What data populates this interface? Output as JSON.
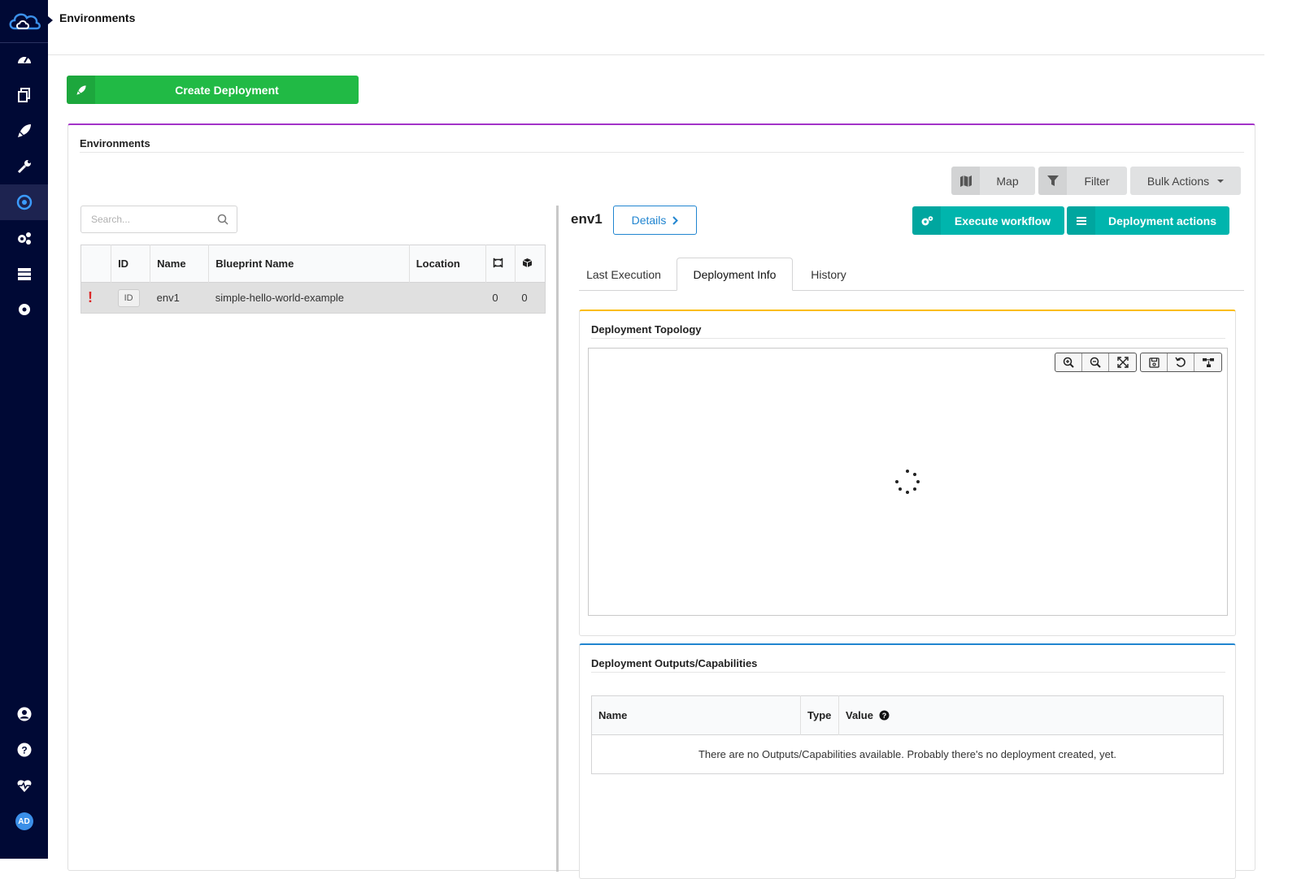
{
  "breadcrumb": "Environments",
  "create_button": "Create Deployment",
  "widget": {
    "title": "Environments",
    "toolbar": {
      "map": "Map",
      "filter": "Filter",
      "bulk_actions": "Bulk Actions"
    },
    "search_placeholder": "Search...",
    "table": {
      "headers": [
        "ID",
        "Name",
        "Blueprint Name",
        "Location"
      ],
      "rows": [
        {
          "id": "ID",
          "name": "env1",
          "blueprint": "simple-hello-world-example",
          "location": "",
          "count1": "0",
          "count2": "0"
        }
      ]
    }
  },
  "detail": {
    "env_name": "env1",
    "details_button": "Details",
    "execute_workflow": "Execute workflow",
    "deployment_actions": "Deployment actions",
    "tabs": [
      "Last Execution",
      "Deployment Info",
      "History"
    ],
    "topology_title": "Deployment Topology",
    "outputs_title": "Deployment Outputs/Capabilities",
    "outputs_headers": {
      "name": "Name",
      "type": "Type",
      "value": "Value"
    },
    "outputs_empty": "There are no Outputs/Capabilities available. Probably there's no deployment created, yet."
  },
  "sidebar": {
    "avatar_initials": "AD",
    "icons": [
      "dashboard-icon",
      "blueprints-icon",
      "deployments-icon",
      "tools-icon",
      "environments-icon",
      "settings-cogs-icon",
      "servers-icon",
      "gear-icon",
      "user-icon",
      "help-icon",
      "health-icon"
    ]
  },
  "colors": {
    "sidebar": "#000935",
    "green": "#21ba45",
    "teal": "#00b5ad",
    "accent_purple": "#a333c8",
    "blue": "#2185d0"
  }
}
